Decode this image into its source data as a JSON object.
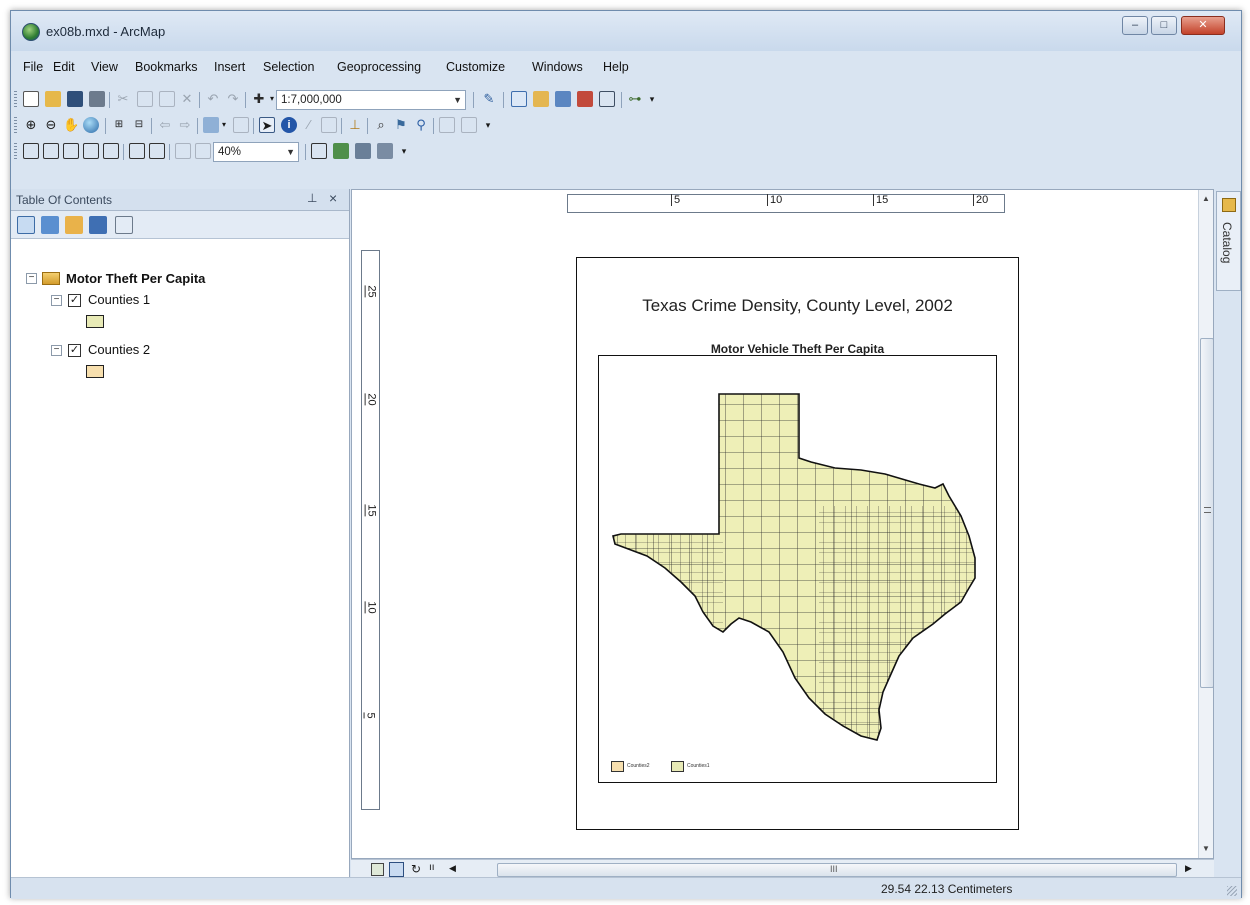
{
  "window": {
    "title": "ex08b.mxd - ArcMap"
  },
  "menu": [
    "File",
    "Edit",
    "View",
    "Bookmarks",
    "Insert",
    "Selection",
    "Geoprocessing",
    "Customize",
    "Windows",
    "Help"
  ],
  "toolbar": {
    "scale": "1:7,000,000",
    "zoom": "40%"
  },
  "toc": {
    "title": "Table Of Contents",
    "dataframe": "Motor Theft Per Capita",
    "layers": [
      {
        "name": "Counties 1",
        "checked": true,
        "swatch": "#e8eab6"
      },
      {
        "name": "Counties 2",
        "checked": true,
        "swatch": "#f7dfae"
      }
    ]
  },
  "ruler": {
    "h_ticks": [
      "5",
      "10",
      "15",
      "20"
    ],
    "v_ticks": [
      "25",
      "20",
      "15",
      "10",
      "5"
    ]
  },
  "layout": {
    "title": "Texas Crime Density, County Level, 2002",
    "subtitle": "Motor Vehicle Theft Per Capita",
    "legend": [
      {
        "label": "Counties2",
        "color": "#f7dfae"
      },
      {
        "label": "Counties1",
        "color": "#e8eab6"
      }
    ],
    "map_fill": "#eeefb7"
  },
  "scrollbar": {
    "thumb_label": "III"
  },
  "catalog": {
    "label": "Catalog"
  },
  "status": {
    "coords": "29.54  22.13 Centimeters"
  }
}
